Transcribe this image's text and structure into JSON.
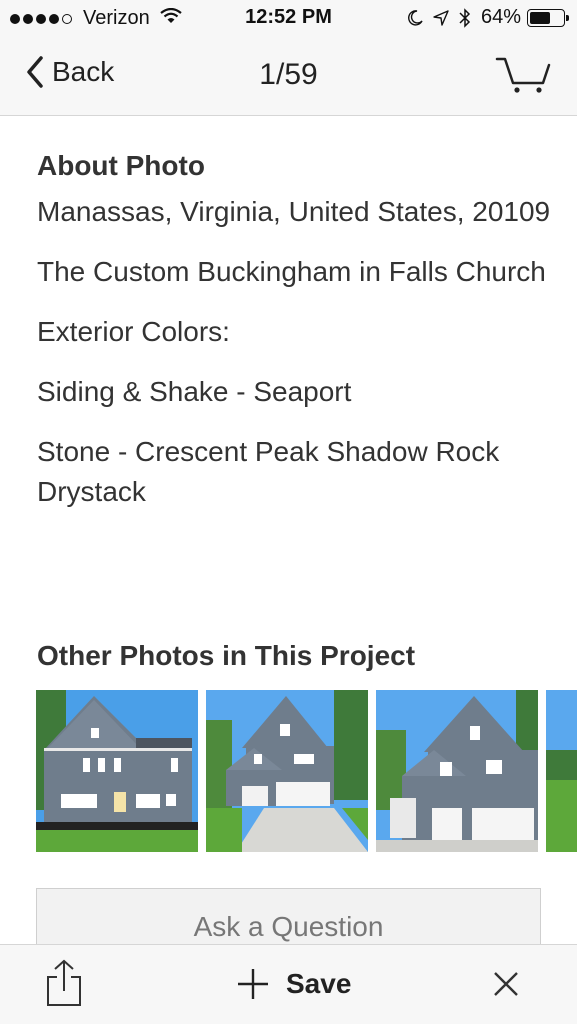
{
  "status_bar": {
    "carrier": "Verizon",
    "time": "12:52 PM",
    "battery": "64%",
    "battery_level": 0.64,
    "signal_bars": 4,
    "icons": [
      "wifi-icon",
      "moon-icon",
      "location-icon",
      "bluetooth-icon",
      "battery-icon"
    ]
  },
  "nav": {
    "back_label": "Back",
    "title": "1/59",
    "cart_icon": "cart-icon"
  },
  "about": {
    "heading": "About Photo",
    "location": "Manassas, Virginia, United States, 20109",
    "lines": [
      "The Custom Buckingham in Falls Church",
      "Exterior Colors:",
      "Siding & Shake - Seaport",
      "Stone - Crescent Peak Shadow Rock Drystack"
    ]
  },
  "other_photos": {
    "heading": "Other Photos in This Project",
    "thumbnails": [
      "house-rear-view",
      "house-front-driveway",
      "house-front-porch",
      "house-partial-greenery"
    ]
  },
  "ask_button": "Ask a Question",
  "toolbar": {
    "share_icon": "share-icon",
    "save_label": "Save",
    "close_icon": "close-icon"
  },
  "colors": {
    "bar_background": "#f7f7f7",
    "text": "#333333",
    "siding": "#6f7d8c",
    "sky": "#4a9fe8",
    "grass": "#5da83a"
  }
}
